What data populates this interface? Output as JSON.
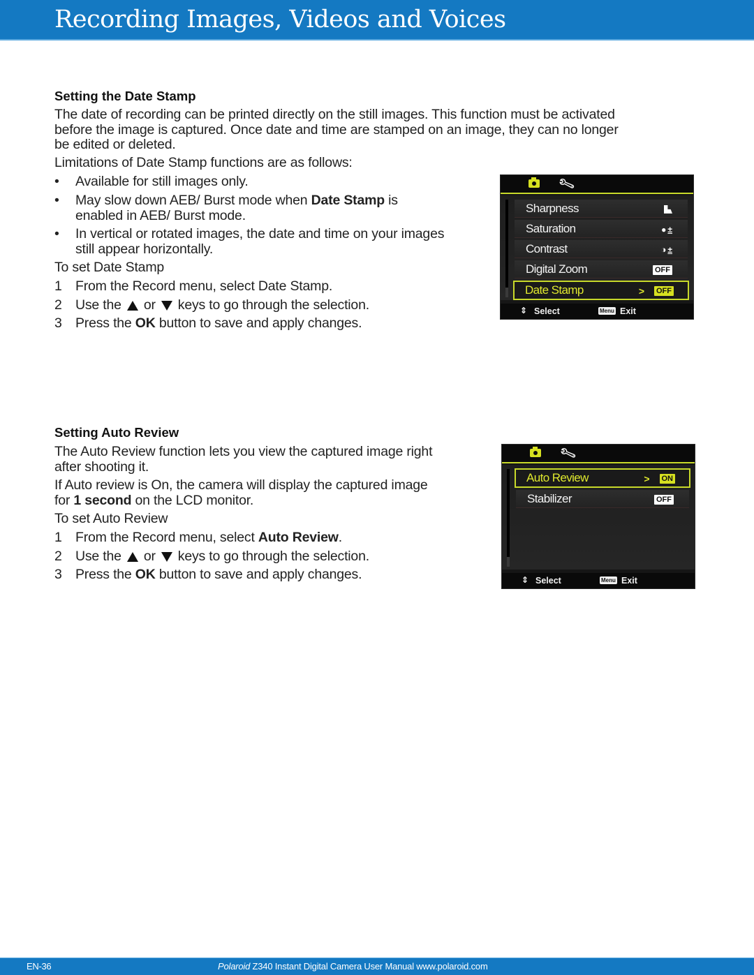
{
  "header": {
    "title": "Recording Images, Videos and Voices"
  },
  "date_stamp_section": {
    "heading": "Setting the Date Stamp",
    "intro_lines": [
      "The date of recording can be printed directly on the still images. This function must be activated",
      "before the image is captured. Once date and time are stamped on an image, they can no longer",
      "be edited or deleted."
    ],
    "limitations_intro": "Limitations of Date Stamp functions are as follows:",
    "bullets": [
      {
        "lines": [
          "Available for still images only."
        ]
      },
      {
        "pre": "May slow down AEB/ Burst mode when ",
        "bold": "Date Stamp",
        "post": " is",
        "line2": "enabled in AEB/ Burst mode."
      },
      {
        "lines": [
          "In vertical or rotated images, the date and time on your images",
          "still appear horizontally."
        ]
      }
    ],
    "bullet_symbol": "•",
    "to_set": "To set Date Stamp",
    "steps": [
      {
        "num": "1",
        "text": "From the Record menu, select Date Stamp."
      },
      {
        "num": "2",
        "pre": "Use the",
        "mid": "or",
        "post": "keys to go through the selection."
      },
      {
        "num": "3",
        "pre": "Press the ",
        "bold": "OK",
        "post": " button to save and apply changes."
      }
    ],
    "camera_screen": {
      "tabs": [
        "camera-icon",
        "wrench-icon"
      ],
      "rows": [
        {
          "label": "Sharpness",
          "value_icon": "sharpness-icon"
        },
        {
          "label": "Saturation",
          "value_icon": "saturation-icon",
          "suffix": "±"
        },
        {
          "label": "Contrast",
          "value_icon": "contrast-icon",
          "suffix": "±"
        },
        {
          "label": "Digital Zoom",
          "value": "OFF"
        },
        {
          "label": "Date Stamp",
          "value": "OFF",
          "selected": true,
          "chevron": ">"
        }
      ],
      "footer": {
        "select_label": "Select",
        "menu_badge": "Menu",
        "exit_label": "Exit"
      }
    }
  },
  "auto_review_section": {
    "heading": "Setting Auto Review",
    "intro_lines": [
      "The Auto Review function lets you view the captured image right",
      "after shooting it."
    ],
    "info": {
      "pre": "If Auto review is On, the camera will display the captured image",
      "line2_pre": "for ",
      "bold": "1 second",
      "line2_post": " on the LCD monitor."
    },
    "to_set": "To set Auto Review",
    "steps": [
      {
        "num": "1",
        "pre": "From the Record menu, select ",
        "bold": "Auto Review",
        "post": "."
      },
      {
        "num": "2",
        "pre": "Use the",
        "mid": "or",
        "post": "keys to go through the selection."
      },
      {
        "num": "3",
        "pre": "Press the ",
        "bold": "OK",
        "post": " button to save and apply changes."
      }
    ],
    "camera_screen": {
      "tabs": [
        "camera-icon",
        "wrench-icon"
      ],
      "rows": [
        {
          "label": "Auto Review",
          "value": "ON",
          "selected": true,
          "chevron": ">"
        },
        {
          "label": "Stabilizer",
          "value": "OFF"
        }
      ],
      "footer": {
        "select_label": "Select",
        "menu_badge": "Menu",
        "exit_label": "Exit"
      }
    }
  },
  "footer": {
    "page": "EN-36",
    "brand": "Polaroid",
    "text": " Z340 Instant Digital Camera User Manual www.polaroid.com"
  },
  "colors": {
    "brand_blue": "#1479c2",
    "highlight_yellow": "#d6e020"
  }
}
